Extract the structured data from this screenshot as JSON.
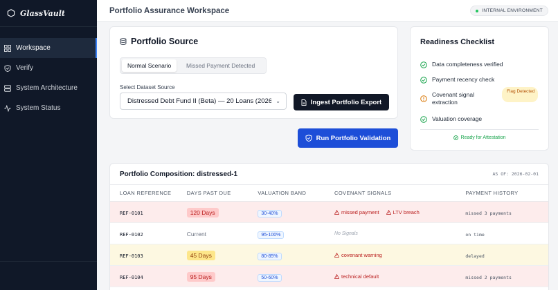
{
  "brand": {
    "name": "GlassVault"
  },
  "nav": [
    {
      "label": "Workspace",
      "icon": "grid-icon",
      "active": true
    },
    {
      "label": "Verify",
      "icon": "shield-check-icon"
    },
    {
      "label": "System Architecture",
      "icon": "server-icon"
    },
    {
      "label": "System Status",
      "icon": "activity-icon"
    }
  ],
  "header": {
    "title": "Portfolio Assurance Workspace",
    "env_badge": "INTERNAL ENVIRONMENT"
  },
  "source": {
    "title": "Portfolio Source",
    "tabs": [
      "Normal Scenario",
      "Missed Payment Detected"
    ],
    "dataset_label": "Select Dataset Source",
    "dataset_value": "Distressed Debt Fund II (Beta) — 20 Loans (2026",
    "ingest_label": "Ingest Portfolio Export"
  },
  "run_label": "Run Portfolio Validation",
  "checklist": {
    "title": "Readiness Checklist",
    "items": [
      "Data completeness verified",
      "Payment recency check",
      "Covenant signal extraction",
      "Valuation coverage"
    ],
    "flag": "Flag Detected",
    "ready": "Ready for Attestation"
  },
  "composition": {
    "title": "Portfolio Composition: distressed-1",
    "as_of": "AS OF: 2026-02-01",
    "headers": [
      "LOAN REFERENCE",
      "DAYS PAST DUE",
      "VALUATION BAND",
      "COVENANT SIGNALS",
      "PAYMENT HISTORY"
    ],
    "rows": [
      {
        "ref": "REF-0101",
        "days": "120 Days",
        "band": "30-40%",
        "signals": [
          "missed payment",
          "LTV breach"
        ],
        "history": "missed 3 payments"
      },
      {
        "ref": "REF-0102",
        "days": "Current",
        "band": "95-100%",
        "signals": [
          "No Signals"
        ],
        "history": "on time"
      },
      {
        "ref": "REF-0103",
        "days": "45 Days",
        "band": "80-85%",
        "signals": [
          "covenant warning"
        ],
        "history": "delayed"
      },
      {
        "ref": "REF-0104",
        "days": "95 Days",
        "band": "50-60%",
        "signals": [
          "technical default"
        ],
        "history": "missed 2 payments"
      }
    ]
  },
  "colors": {
    "sidebar_bg": "#101828",
    "accent": "#1d4ed8",
    "ok": "#16a34a",
    "warn": "#d97706",
    "danger": "#b91c1c"
  }
}
